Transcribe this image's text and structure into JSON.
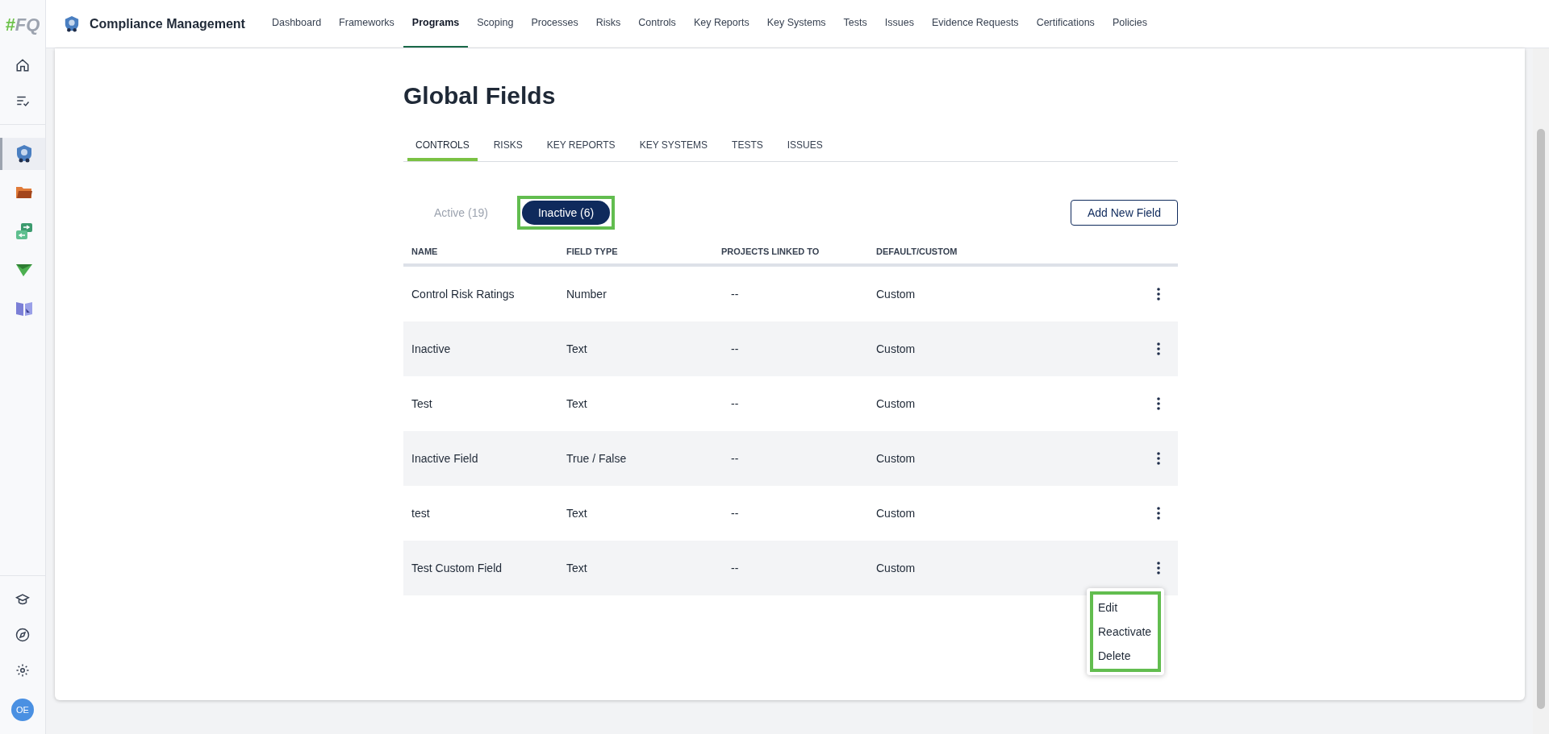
{
  "app": {
    "logo": {
      "mark": "#",
      "text": "FQ"
    },
    "title": "Compliance Management"
  },
  "nav": [
    {
      "label": "Dashboard",
      "selected": false
    },
    {
      "label": "Frameworks",
      "selected": false
    },
    {
      "label": "Programs",
      "selected": true
    },
    {
      "label": "Scoping",
      "selected": false
    },
    {
      "label": "Processes",
      "selected": false
    },
    {
      "label": "Risks",
      "selected": false
    },
    {
      "label": "Controls",
      "selected": false
    },
    {
      "label": "Key Reports",
      "selected": false
    },
    {
      "label": "Key Systems",
      "selected": false
    },
    {
      "label": "Tests",
      "selected": false
    },
    {
      "label": "Issues",
      "selected": false
    },
    {
      "label": "Evidence Requests",
      "selected": false
    },
    {
      "label": "Certifications",
      "selected": false
    },
    {
      "label": "Policies",
      "selected": false
    }
  ],
  "sidebar": {
    "apps": [
      {
        "kind": "badge",
        "selected": true
      },
      {
        "kind": "folder",
        "selected": false
      },
      {
        "kind": "sync",
        "selected": false
      },
      {
        "kind": "plane",
        "selected": false
      },
      {
        "kind": "book",
        "selected": false
      }
    ],
    "avatar": "OE"
  },
  "page": {
    "title": "Global Fields",
    "tabs": [
      {
        "label": "CONTROLS",
        "selected": true
      },
      {
        "label": "RISKS",
        "selected": false
      },
      {
        "label": "KEY REPORTS",
        "selected": false
      },
      {
        "label": "KEY SYSTEMS",
        "selected": false
      },
      {
        "label": "TESTS",
        "selected": false
      },
      {
        "label": "ISSUES",
        "selected": false
      }
    ],
    "filters": [
      {
        "label": "Active (19)",
        "selected": false,
        "highlighted": false
      },
      {
        "label": "Inactive (6)",
        "selected": true,
        "highlighted": true
      }
    ],
    "add_button": "Add New Field",
    "table": {
      "columns": [
        "NAME",
        "FIELD TYPE",
        "PROJECTS LINKED TO",
        "DEFAULT/CUSTOM"
      ],
      "rows": [
        {
          "cells": [
            "Control Risk Ratings",
            "Number",
            "--",
            "Custom"
          ]
        },
        {
          "cells": [
            "Inactive",
            "Text",
            "--",
            "Custom"
          ]
        },
        {
          "cells": [
            "Test",
            "Text",
            "--",
            "Custom"
          ]
        },
        {
          "cells": [
            "Inactive Field",
            "True / False",
            "--",
            "Custom"
          ]
        },
        {
          "cells": [
            "test",
            "Text",
            "--",
            "Custom"
          ]
        },
        {
          "cells": [
            "Test Custom Field",
            "Text",
            "--",
            "Custom"
          ]
        }
      ]
    },
    "menu": {
      "highlighted": true,
      "items": [
        "Edit",
        "Reactivate",
        "Delete"
      ]
    }
  }
}
